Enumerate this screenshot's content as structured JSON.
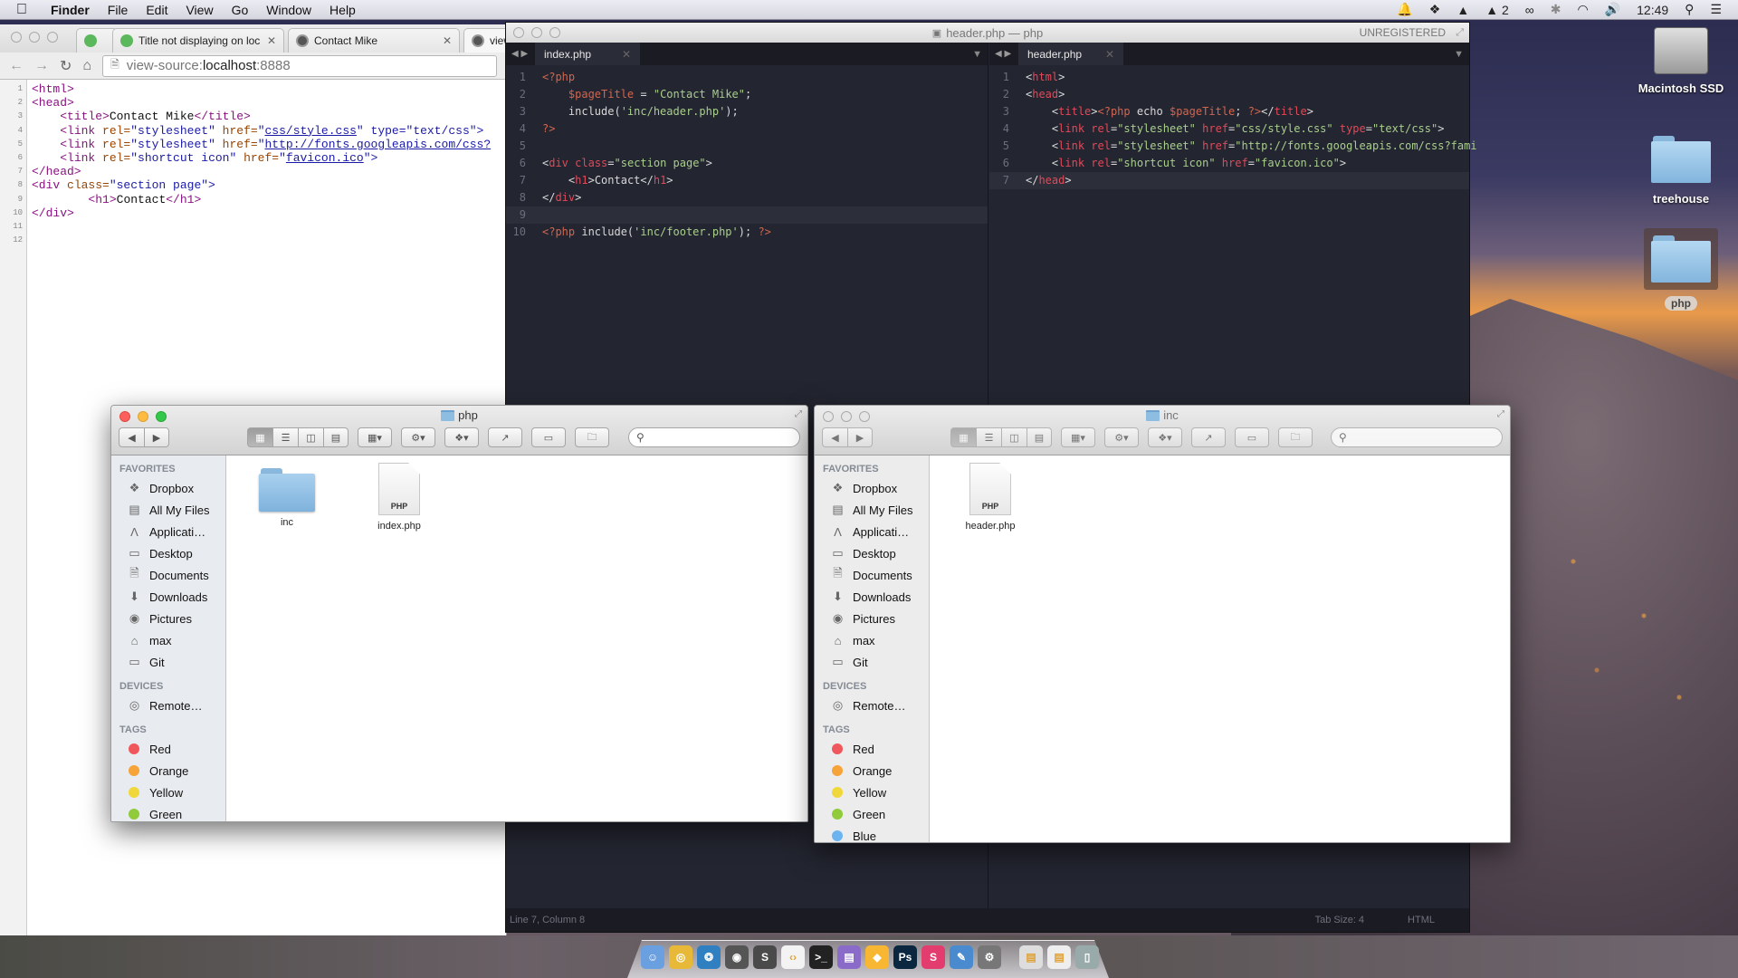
{
  "menubar": {
    "app_name": "Finder",
    "menus": [
      "File",
      "Edit",
      "View",
      "Go",
      "Window",
      "Help"
    ],
    "adobe_badge": "2",
    "clock": "12:49"
  },
  "browser": {
    "tabs": [
      {
        "title": ""
      },
      {
        "title": "Title not displaying on loc"
      },
      {
        "title": "Contact Mike"
      },
      {
        "title": "view"
      }
    ],
    "url_scheme": "view-source:",
    "url_host": "localhost",
    "url_port": ":8888",
    "line_numbers": [
      "1",
      "2",
      "3",
      "4",
      "5",
      "6",
      "7",
      "8",
      "9",
      "10",
      "11",
      "12"
    ],
    "source": {
      "l1": "<html>",
      "l2": "<head>",
      "l3_open": "<title>",
      "l3_text": "Contact Mike",
      "l3_close": "</title>",
      "l4_a": "<link ",
      "l4_rel_attr": "rel=",
      "l4_rel_val": "\"stylesheet\" ",
      "l4_href_attr": "href=",
      "l4_href_q": "\"",
      "l4_href_link": "css/style.css",
      "l4_type": "\" type=",
      "l4_type_val": "\"text/css\">",
      "l5_rel_val": "\"stylesheet\" ",
      "l5_href_link": "http://fonts.googleapis.com/css?",
      "l6_rel_val": "\"shortcut icon\" ",
      "l6_href_link": "favicon.ico",
      "l6_end": "\">",
      "l7": "</head>",
      "l8_open": "<div ",
      "l8_attr": "class=",
      "l8_val": "\"section page\">",
      "l9_open": "<h1>",
      "l9_text": "Contact",
      "l9_close": "</h1>",
      "l10": "</div>"
    }
  },
  "sublime": {
    "window_title": "header.php — php",
    "unregistered": "UNREGISTERED",
    "left_tab": "index.php",
    "right_tab": "header.php",
    "left_lines": [
      "1",
      "2",
      "3",
      "4",
      "5",
      "6",
      "7",
      "8",
      "9",
      "10"
    ],
    "right_lines": [
      "1",
      "2",
      "3",
      "4",
      "5",
      "6",
      "7"
    ],
    "left_code": {
      "l1": "<?php",
      "l2_var": "$pageTitle",
      "l2_eq": " = ",
      "l2_str": "\"Contact Mike\"",
      "l2_end": ";",
      "l3_fn": "include(",
      "l3_str": "'inc/header.php'",
      "l3_end": ");",
      "l4": "?>",
      "l6_lt": "<",
      "l6_tag": "div",
      "l6_attr": " class",
      "l6_eq": "=",
      "l6_str": "\"section page\"",
      "l6_gt": ">",
      "l7_lt": "<",
      "l7_tag": "h1",
      "l7_mid": ">Contact</",
      "l7_tag2": "h1",
      "l7_gt": ">",
      "l8_lt": "</",
      "l8_tag": "div",
      "l8_gt": ">",
      "l10_php": "<?php",
      "l10_fn": " include(",
      "l10_str": "'inc/footer.php'",
      "l10_end": "); ",
      "l10_close": "?>"
    },
    "right_code": {
      "l1_lt": "<",
      "l1_tag": "html",
      "l1_gt": ">",
      "l2_lt": "<",
      "l2_tag": "head",
      "l2_gt": ">",
      "l3_lt": "<",
      "l3_tag": "title",
      "l3_gt": ">",
      "l3_php": "<?php",
      "l3_echo": " echo ",
      "l3_var": "$pageTitle",
      "l3_semi": "; ",
      "l3_close": "?>",
      "l3_lt2": "</",
      "l3_tag2": "title",
      "l3_gt2": ">",
      "link_tag": "link",
      "rel": " rel",
      "eq": "=",
      "href": " href",
      "type": " type",
      "l4_rel": "\"stylesheet\"",
      "l4_href": "\"css/style.css\"",
      "l4_type": "\"text/css\"",
      "l5_rel": "\"stylesheet\"",
      "l5_href": "\"http://fonts.googleapis.com/css?fami",
      "l6_rel": "\"shortcut icon\"",
      "l6_href": "\"favicon.ico\"",
      "l7_lt": "</",
      "l7_tag": "head",
      "l7_gt": ">"
    },
    "status_left": "Line 7, Column 8",
    "tab_size": "Tab Size: 4",
    "syntax": "HTML"
  },
  "finder_php": {
    "title": "php",
    "sections": {
      "favorites": "FAVORITES",
      "devices": "DEVICES",
      "tags": "TAGS"
    },
    "favorites": [
      "Dropbox",
      "All My Files",
      "Applicati…",
      "Desktop",
      "Documents",
      "Downloads",
      "Pictures",
      "max",
      "Git"
    ],
    "devices": [
      "Remote…"
    ],
    "tags": [
      {
        "name": "Red",
        "color": "#f0575c"
      },
      {
        "name": "Orange",
        "color": "#f6a33a"
      },
      {
        "name": "Yellow",
        "color": "#f1d83a"
      },
      {
        "name": "Green",
        "color": "#8fcb3b"
      }
    ],
    "files": [
      {
        "name": "inc",
        "type": "folder"
      },
      {
        "name": "index.php",
        "type": "php",
        "badge": "PHP"
      }
    ]
  },
  "finder_inc": {
    "title": "inc",
    "sections": {
      "favorites": "FAVORITES",
      "devices": "DEVICES",
      "tags": "TAGS"
    },
    "favorites": [
      "Dropbox",
      "All My Files",
      "Applicati…",
      "Desktop",
      "Documents",
      "Downloads",
      "Pictures",
      "max",
      "Git"
    ],
    "devices": [
      "Remote…"
    ],
    "tags": [
      {
        "name": "Red",
        "color": "#f0575c"
      },
      {
        "name": "Orange",
        "color": "#f6a33a"
      },
      {
        "name": "Yellow",
        "color": "#f1d83a"
      },
      {
        "name": "Green",
        "color": "#8fcb3b"
      },
      {
        "name": "Blue",
        "color": "#6cb4ef"
      }
    ],
    "files": [
      {
        "name": "header.php",
        "type": "php",
        "badge": "PHP"
      }
    ]
  },
  "desktop": {
    "icons": [
      "Macintosh SSD",
      "treehouse",
      "php"
    ]
  },
  "dock": {
    "apps": [
      "Finder",
      "Chrome",
      "Sourcetree",
      "Sequel Pro",
      "Sublime Text",
      "Coda",
      "Terminal",
      "Stack",
      "Sketch",
      "Photoshop",
      "Slack",
      "Preview",
      "System Preferences",
      "Document",
      "Document 2",
      "Trash"
    ]
  }
}
